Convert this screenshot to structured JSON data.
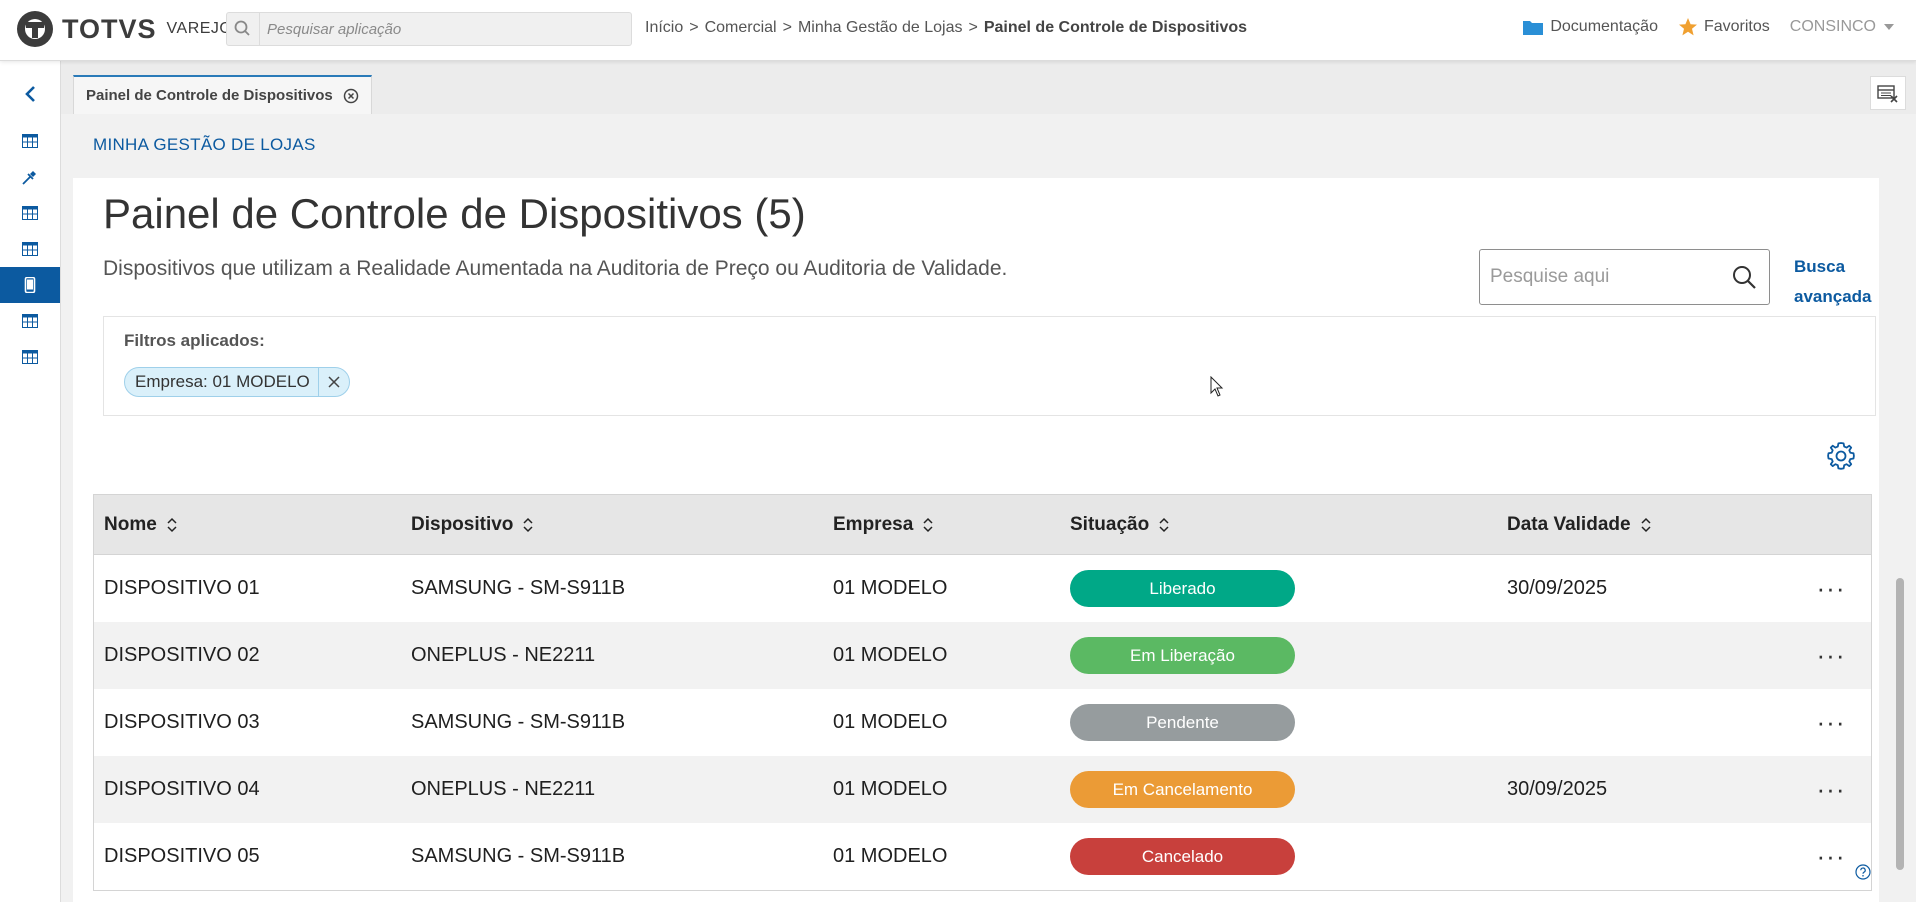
{
  "header": {
    "logo_text": "TOTVS",
    "logo_sub": "VAREJO",
    "app_search_placeholder": "Pesquisar aplicação",
    "breadcrumb": [
      "Início",
      "Comercial",
      "Minha Gestão de Lojas",
      "Painel de Controle de Dispositivos"
    ],
    "breadcrumb_sep": ">",
    "documentation": "Documentação",
    "favorites": "Favoritos",
    "user": "CONSINCO"
  },
  "tab": {
    "label": "Painel de Controle de Dispositivos"
  },
  "module_title": "MINHA GESTÃO DE LOJAS",
  "page": {
    "title": "Painel de Controle de Dispositivos (5)",
    "subtitle": "Dispositivos que utilizam a Realidade Aumentada na Auditoria de Preço ou Auditoria de Validade.",
    "search_placeholder": "Pesquise aqui",
    "advanced_search": "Busca avançada"
  },
  "filters": {
    "label": "Filtros aplicados:",
    "chips": [
      "Empresa: 01 MODELO"
    ]
  },
  "table": {
    "columns": [
      "Nome",
      "Dispositivo",
      "Empresa",
      "Situação",
      "Data Validade"
    ],
    "rows": [
      {
        "nome": "DISPOSITIVO 01",
        "dispositivo": "SAMSUNG - SM-S911B",
        "empresa": "01 MODELO",
        "situacao": "Liberado",
        "data_validade": "30/09/2025"
      },
      {
        "nome": "DISPOSITIVO 02",
        "dispositivo": "ONEPLUS - NE2211",
        "empresa": "01 MODELO",
        "situacao": "Em Liberação",
        "data_validade": ""
      },
      {
        "nome": "DISPOSITIVO 03",
        "dispositivo": "SAMSUNG - SM-S911B",
        "empresa": "01 MODELO",
        "situacao": "Pendente",
        "data_validade": ""
      },
      {
        "nome": "DISPOSITIVO 04",
        "dispositivo": "ONEPLUS - NE2211",
        "empresa": "01 MODELO",
        "situacao": "Em Cancelamento",
        "data_validade": "30/09/2025"
      },
      {
        "nome": "DISPOSITIVO 05",
        "dispositivo": "SAMSUNG - SM-S911B",
        "empresa": "01 MODELO",
        "situacao": "Cancelado",
        "data_validade": ""
      }
    ],
    "more_label": "···"
  },
  "status_colors": {
    "Liberado": "#00a887",
    "Em Liberação": "#5bb963",
    "Pendente": "#969c9e",
    "Em Cancelamento": "#eb9b36",
    "Cancelado": "#c8403c"
  },
  "colors": {
    "brand": "#0c5aa0",
    "text": "#1d1d1d"
  },
  "sidebar": {
    "icons": [
      "chevron-left-icon",
      "table-icon",
      "pin-icon",
      "table-icon",
      "table-icon",
      "mobile-device-icon",
      "table-icon",
      "table-icon"
    ],
    "active_index": 5
  }
}
